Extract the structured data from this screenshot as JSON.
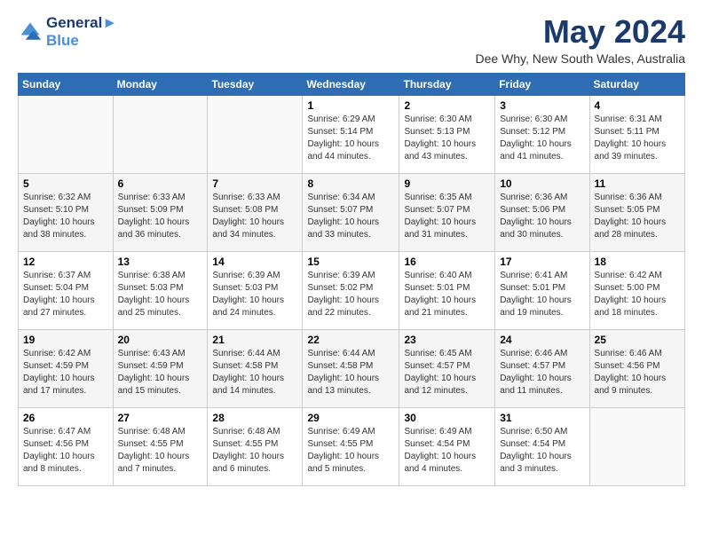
{
  "logo": {
    "line1": "General",
    "line2": "Blue"
  },
  "title": "May 2024",
  "location": "Dee Why, New South Wales, Australia",
  "days_header": [
    "Sunday",
    "Monday",
    "Tuesday",
    "Wednesday",
    "Thursday",
    "Friday",
    "Saturday"
  ],
  "weeks": [
    [
      {
        "num": "",
        "info": ""
      },
      {
        "num": "",
        "info": ""
      },
      {
        "num": "",
        "info": ""
      },
      {
        "num": "1",
        "info": "Sunrise: 6:29 AM\nSunset: 5:14 PM\nDaylight: 10 hours\nand 44 minutes."
      },
      {
        "num": "2",
        "info": "Sunrise: 6:30 AM\nSunset: 5:13 PM\nDaylight: 10 hours\nand 43 minutes."
      },
      {
        "num": "3",
        "info": "Sunrise: 6:30 AM\nSunset: 5:12 PM\nDaylight: 10 hours\nand 41 minutes."
      },
      {
        "num": "4",
        "info": "Sunrise: 6:31 AM\nSunset: 5:11 PM\nDaylight: 10 hours\nand 39 minutes."
      }
    ],
    [
      {
        "num": "5",
        "info": "Sunrise: 6:32 AM\nSunset: 5:10 PM\nDaylight: 10 hours\nand 38 minutes."
      },
      {
        "num": "6",
        "info": "Sunrise: 6:33 AM\nSunset: 5:09 PM\nDaylight: 10 hours\nand 36 minutes."
      },
      {
        "num": "7",
        "info": "Sunrise: 6:33 AM\nSunset: 5:08 PM\nDaylight: 10 hours\nand 34 minutes."
      },
      {
        "num": "8",
        "info": "Sunrise: 6:34 AM\nSunset: 5:07 PM\nDaylight: 10 hours\nand 33 minutes."
      },
      {
        "num": "9",
        "info": "Sunrise: 6:35 AM\nSunset: 5:07 PM\nDaylight: 10 hours\nand 31 minutes."
      },
      {
        "num": "10",
        "info": "Sunrise: 6:36 AM\nSunset: 5:06 PM\nDaylight: 10 hours\nand 30 minutes."
      },
      {
        "num": "11",
        "info": "Sunrise: 6:36 AM\nSunset: 5:05 PM\nDaylight: 10 hours\nand 28 minutes."
      }
    ],
    [
      {
        "num": "12",
        "info": "Sunrise: 6:37 AM\nSunset: 5:04 PM\nDaylight: 10 hours\nand 27 minutes."
      },
      {
        "num": "13",
        "info": "Sunrise: 6:38 AM\nSunset: 5:03 PM\nDaylight: 10 hours\nand 25 minutes."
      },
      {
        "num": "14",
        "info": "Sunrise: 6:39 AM\nSunset: 5:03 PM\nDaylight: 10 hours\nand 24 minutes."
      },
      {
        "num": "15",
        "info": "Sunrise: 6:39 AM\nSunset: 5:02 PM\nDaylight: 10 hours\nand 22 minutes."
      },
      {
        "num": "16",
        "info": "Sunrise: 6:40 AM\nSunset: 5:01 PM\nDaylight: 10 hours\nand 21 minutes."
      },
      {
        "num": "17",
        "info": "Sunrise: 6:41 AM\nSunset: 5:01 PM\nDaylight: 10 hours\nand 19 minutes."
      },
      {
        "num": "18",
        "info": "Sunrise: 6:42 AM\nSunset: 5:00 PM\nDaylight: 10 hours\nand 18 minutes."
      }
    ],
    [
      {
        "num": "19",
        "info": "Sunrise: 6:42 AM\nSunset: 4:59 PM\nDaylight: 10 hours\nand 17 minutes."
      },
      {
        "num": "20",
        "info": "Sunrise: 6:43 AM\nSunset: 4:59 PM\nDaylight: 10 hours\nand 15 minutes."
      },
      {
        "num": "21",
        "info": "Sunrise: 6:44 AM\nSunset: 4:58 PM\nDaylight: 10 hours\nand 14 minutes."
      },
      {
        "num": "22",
        "info": "Sunrise: 6:44 AM\nSunset: 4:58 PM\nDaylight: 10 hours\nand 13 minutes."
      },
      {
        "num": "23",
        "info": "Sunrise: 6:45 AM\nSunset: 4:57 PM\nDaylight: 10 hours\nand 12 minutes."
      },
      {
        "num": "24",
        "info": "Sunrise: 6:46 AM\nSunset: 4:57 PM\nDaylight: 10 hours\nand 11 minutes."
      },
      {
        "num": "25",
        "info": "Sunrise: 6:46 AM\nSunset: 4:56 PM\nDaylight: 10 hours\nand 9 minutes."
      }
    ],
    [
      {
        "num": "26",
        "info": "Sunrise: 6:47 AM\nSunset: 4:56 PM\nDaylight: 10 hours\nand 8 minutes."
      },
      {
        "num": "27",
        "info": "Sunrise: 6:48 AM\nSunset: 4:55 PM\nDaylight: 10 hours\nand 7 minutes."
      },
      {
        "num": "28",
        "info": "Sunrise: 6:48 AM\nSunset: 4:55 PM\nDaylight: 10 hours\nand 6 minutes."
      },
      {
        "num": "29",
        "info": "Sunrise: 6:49 AM\nSunset: 4:55 PM\nDaylight: 10 hours\nand 5 minutes."
      },
      {
        "num": "30",
        "info": "Sunrise: 6:49 AM\nSunset: 4:54 PM\nDaylight: 10 hours\nand 4 minutes."
      },
      {
        "num": "31",
        "info": "Sunrise: 6:50 AM\nSunset: 4:54 PM\nDaylight: 10 hours\nand 3 minutes."
      },
      {
        "num": "",
        "info": ""
      }
    ]
  ]
}
